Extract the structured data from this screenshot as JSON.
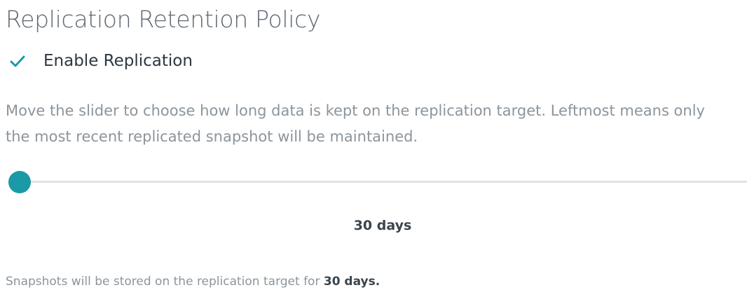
{
  "page": {
    "title": "Replication Retention Policy"
  },
  "enable_replication": {
    "label": "Enable Replication",
    "checked": true,
    "check_color": "#1a9aa6",
    "icon": "check-icon"
  },
  "description": {
    "line1": "Move the slider to choose how long data is kept on the replication target. Leftmost means only",
    "line2": "the most recent replicated snapshot will be maintained."
  },
  "retention_slider": {
    "value_label": "30 days",
    "position_fraction": 0.0,
    "handle_color": "#1a9aa6",
    "track_color": "#dce3e7"
  },
  "summary": {
    "prefix": "Snapshots will be stored on the replication target for ",
    "value": "30 days."
  }
}
